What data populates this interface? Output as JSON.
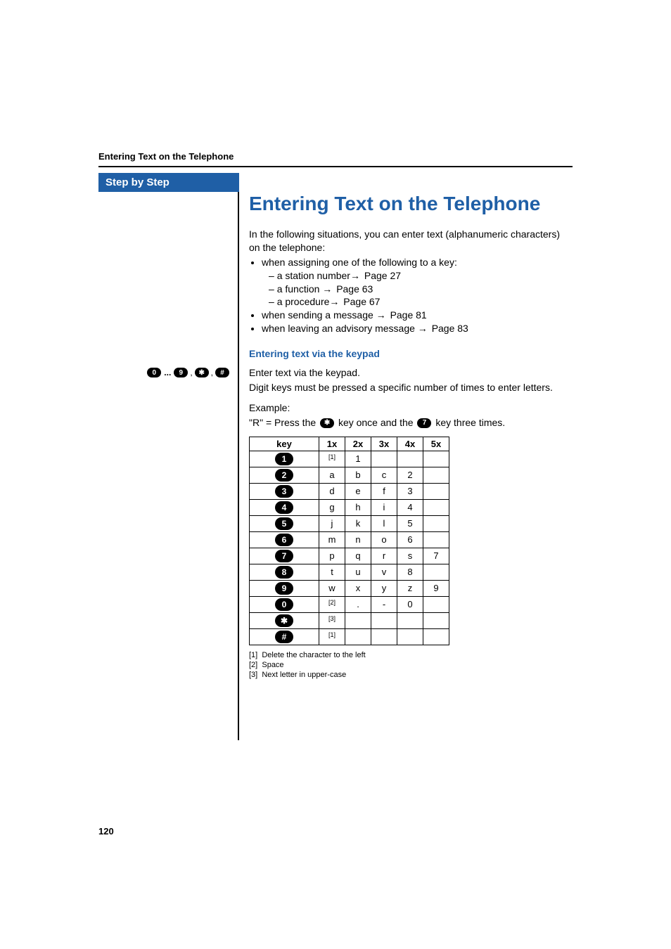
{
  "running_head": "Entering Text on the Telephone",
  "sbs_label": "Step by Step",
  "sidebar_keys": {
    "first": "0",
    "dots": "...",
    "second": "9",
    "sep": ",",
    "third": "✱",
    "fourth": "#"
  },
  "section_title": "Entering Text on the Telephone",
  "intro": "In the following situations, you can enter text (alphanumeric characters) on the telephone:",
  "bullet1": "when assigning one of the following to a key:",
  "sub1a_text": "a station number",
  "sub1a_ref": "Page 27",
  "sub1b_text": "a function ",
  "sub1b_ref": "Page 63",
  "sub1c_text": "a procedure",
  "sub1c_ref": "Page 67",
  "bullet2_text": "when sending a message ",
  "bullet2_ref": "Page 81",
  "bullet3_text": "when leaving an advisory message ",
  "bullet3_ref": "Page 83",
  "arrow": "→",
  "sub_head": "Entering text via the keypad",
  "p1": "Enter text via the keypad.",
  "p2": "Digit keys must be pressed a specific number of times to enter letters.",
  "example_label": "Example:",
  "example_pre": "\"R\" = Press the ",
  "example_mid": " key once and the ",
  "example_post": " key three times.",
  "pill_star": "✱",
  "pill_7": "7",
  "table": {
    "headers": [
      "key",
      "1x",
      "2x",
      "3x",
      "4x",
      "5x"
    ],
    "rows": [
      {
        "key": "1",
        "cells": [
          "[1]",
          "1",
          "",
          "",
          ""
        ]
      },
      {
        "key": "2",
        "cells": [
          "a",
          "b",
          "c",
          "2",
          ""
        ]
      },
      {
        "key": "3",
        "cells": [
          "d",
          "e",
          "f",
          "3",
          ""
        ]
      },
      {
        "key": "4",
        "cells": [
          "g",
          "h",
          "i",
          "4",
          ""
        ]
      },
      {
        "key": "5",
        "cells": [
          "j",
          "k",
          "l",
          "5",
          ""
        ]
      },
      {
        "key": "6",
        "cells": [
          "m",
          "n",
          "o",
          "6",
          ""
        ]
      },
      {
        "key": "7",
        "cells": [
          "p",
          "q",
          "r",
          "s",
          "7"
        ]
      },
      {
        "key": "8",
        "cells": [
          "t",
          "u",
          "v",
          "8",
          ""
        ]
      },
      {
        "key": "9",
        "cells": [
          "w",
          "x",
          "y",
          "z",
          "9"
        ]
      },
      {
        "key": "0",
        "cells": [
          "[2]",
          ".",
          "-",
          "0",
          ""
        ]
      },
      {
        "key": "✱",
        "cells": [
          "[3]",
          "",
          "",
          "",
          ""
        ]
      },
      {
        "key": "#",
        "cells": [
          "[1]",
          "",
          "",
          "",
          ""
        ]
      }
    ]
  },
  "footnotes": {
    "f1": "Delete the character to the left",
    "f1_tag": "[1]",
    "f2": "Space",
    "f2_tag": "[2]",
    "f3": "Next letter in upper-case",
    "f3_tag": "[3]"
  },
  "page_number": "120"
}
